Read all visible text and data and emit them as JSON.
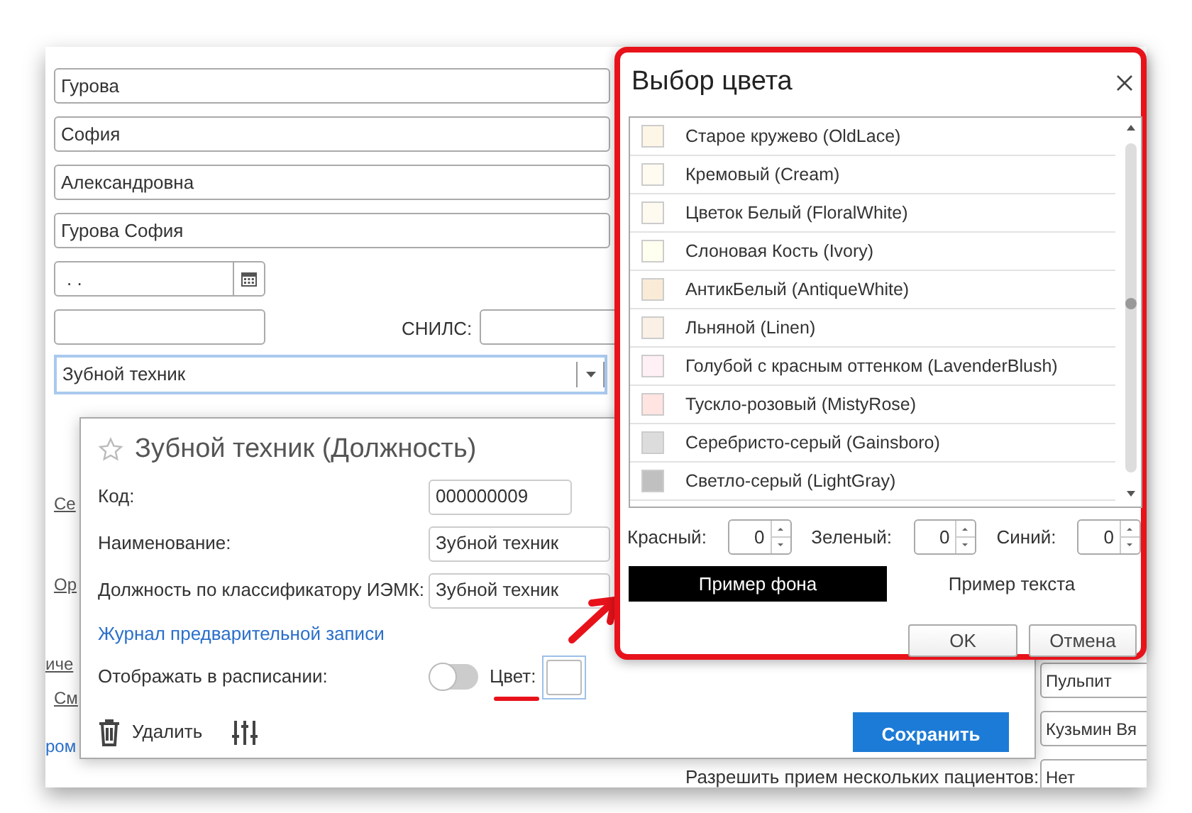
{
  "employee_form": {
    "fields": [
      {
        "value": "Гурова"
      },
      {
        "value": "София"
      },
      {
        "value": "Александровна"
      },
      {
        "value": "Гурова София"
      }
    ],
    "date_field": {
      "value": ". ."
    },
    "snils_label": "СНИЛС:",
    "position_select": {
      "value": "Зубной техник"
    },
    "side_links": [
      {
        "text": "Се",
        "kind": "link"
      },
      {
        "text": "Ор",
        "kind": "link"
      },
      {
        "text": "иче",
        "kind": "link"
      },
      {
        "text": "См",
        "kind": "link"
      },
      {
        "text": "ром",
        "kind": "action"
      }
    ],
    "right_fields": [
      {
        "value": "Пульпит"
      },
      {
        "value": "Кузьмин Вя"
      },
      {
        "value": "Нет"
      }
    ],
    "allow_label": "Разрешить прием нескольких пациентов:"
  },
  "position_dialog": {
    "title": "Зубной техник (Должность)",
    "rows": [
      {
        "label": "Код:",
        "value": "000000009"
      },
      {
        "label": "Наименование:",
        "value": "Зубной техник"
      },
      {
        "label": "Должность по классификатору ИЭМК:",
        "value": "Зубной техник"
      }
    ],
    "journal_link": "Журнал предварительной записи",
    "schedule_label": "Отображать в расписании:",
    "schedule_on": false,
    "color_label": "Цвет:",
    "delete_button": "Удалить",
    "save_button": "Сохранить"
  },
  "color_dialog": {
    "title": "Выбор цвета",
    "colors": [
      {
        "name": "Старое кружево (OldLace)",
        "color": "#fdf5e6"
      },
      {
        "name": "Кремовый (Cream)",
        "color": "#fffbf0"
      },
      {
        "name": "Цветок Белый (FloralWhite)",
        "color": "#fffaf0"
      },
      {
        "name": "Слоновая Кость (Ivory)",
        "color": "#fffff0"
      },
      {
        "name": "АнтикБелый (AntiqueWhite)",
        "color": "#faebd7"
      },
      {
        "name": "Льняной (Linen)",
        "color": "#faf0e6"
      },
      {
        "name": "Голубой с красным оттенком (LavenderBlush)",
        "color": "#fff0f5"
      },
      {
        "name": "Тускло-розовый (MistyRose)",
        "color": "#ffe4e1"
      },
      {
        "name": "Серебристо-серый (Gainsboro)",
        "color": "#dcdcdc"
      },
      {
        "name": "Светло-серый (LightGray)",
        "color": "#c0c0c0"
      }
    ],
    "channels": [
      {
        "label": "Красный:",
        "value": "0"
      },
      {
        "label": "Зеленый:",
        "value": "0"
      },
      {
        "label": "Синий:",
        "value": "0"
      }
    ],
    "background_sample": "Пример фона",
    "text_sample": "Пример текста",
    "buttons": [
      "OK",
      "Отмена"
    ]
  }
}
